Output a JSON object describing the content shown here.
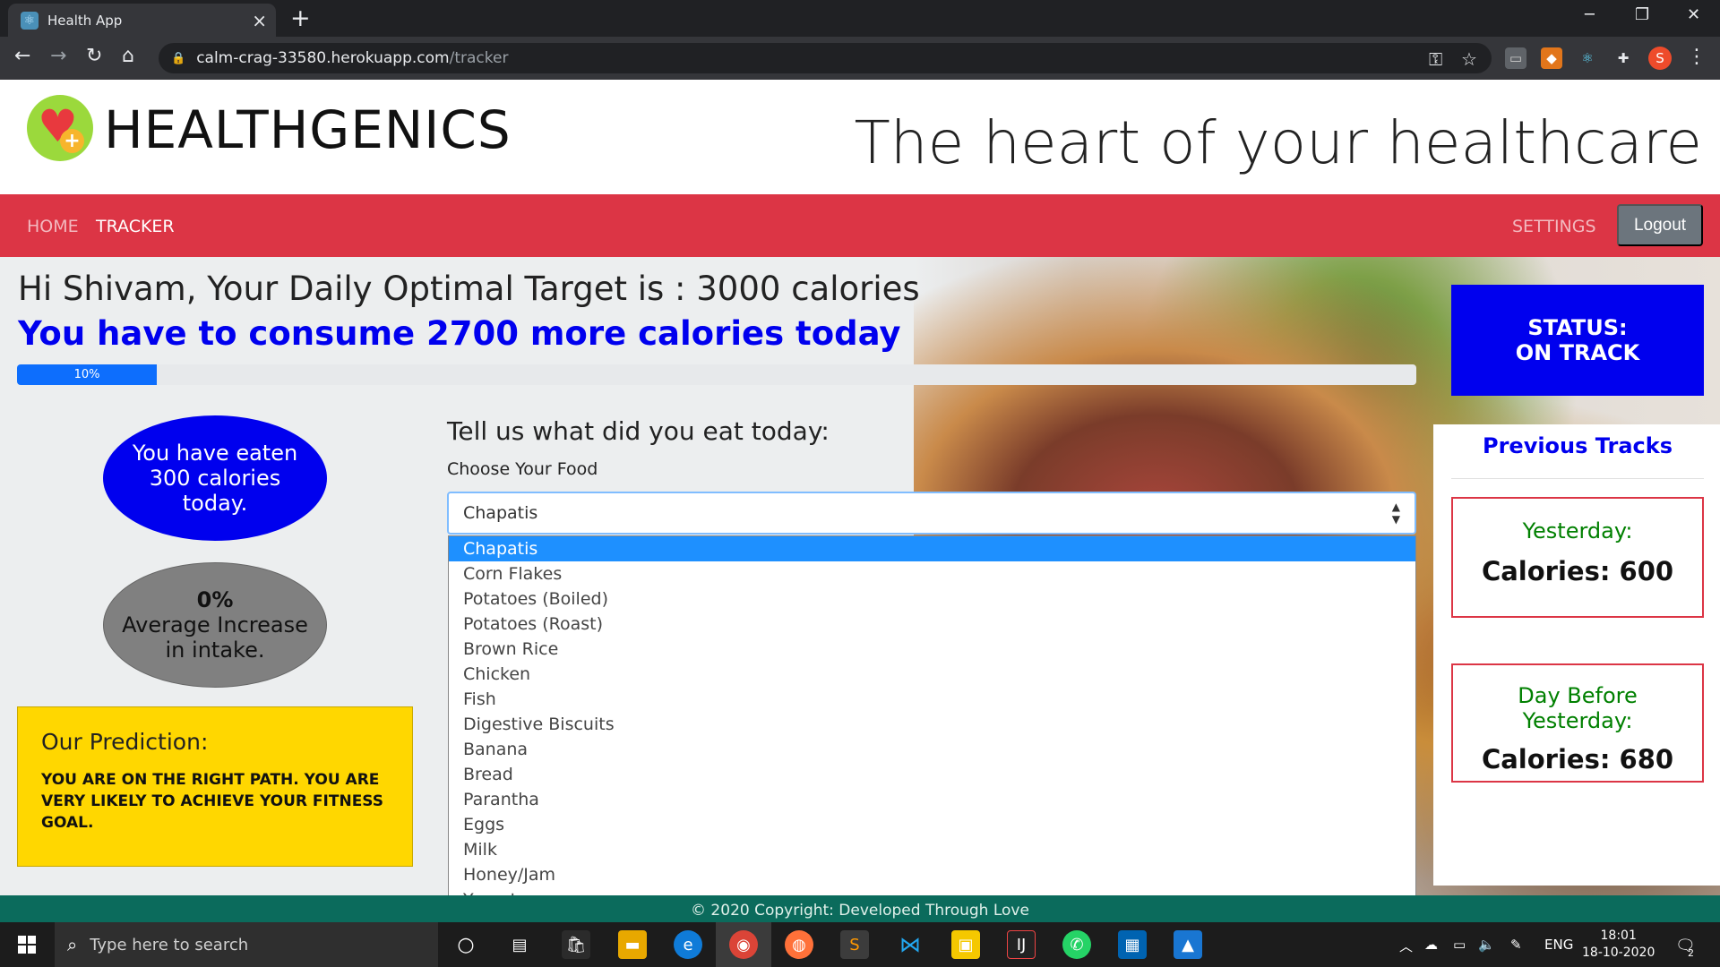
{
  "browser": {
    "tab_title": "Health App",
    "url_host": "calm-crag-33580.herokuapp.com",
    "url_path": "/tracker",
    "profile_initial": "S"
  },
  "header": {
    "brand": "HEALTHGENICS",
    "tagline": "The heart of your healthcare"
  },
  "nav": {
    "home": "HOME",
    "tracker": "TRACKER",
    "settings": "SETTINGS",
    "logout": "Logout"
  },
  "summary": {
    "greeting": "Hi Shivam, Your Daily Optimal Target is : 3000 calories",
    "remaining": "You have to consume 2700 more calories today",
    "progress_label": "10%",
    "progress_value": 0.1
  },
  "status": {
    "line1": "STATUS:",
    "line2": "ON TRACK"
  },
  "eaten": {
    "line1": "You have eaten",
    "line2": "300 calories",
    "line3": "today."
  },
  "average": {
    "percent": "0%",
    "line2": "Average Increase",
    "line3": "in intake."
  },
  "prediction": {
    "title": "Our Prediction:",
    "text": "YOU ARE ON THE RIGHT PATH. YOU ARE VERY LIKELY TO ACHIEVE YOUR FITNESS GOAL."
  },
  "form": {
    "question": "Tell us what did you eat today:",
    "label": "Choose Your Food",
    "selected": "Chapatis",
    "options": [
      "Chapatis",
      "Corn Flakes",
      "Potatoes (Boiled)",
      "Potatoes (Roast)",
      "Brown Rice",
      "Chicken",
      "Fish",
      "Digestive Biscuits",
      "Banana",
      "Bread",
      "Parantha",
      "Eggs",
      "Milk",
      "Honey/Jam",
      "Yogurt"
    ]
  },
  "tracks": {
    "title": "Previous Tracks",
    "yesterday_label": "Yesterday:",
    "yesterday_cal": "Calories: 600",
    "daybefore_label1": "Day Before",
    "daybefore_label2": "Yesterday:",
    "daybefore_cal": "Calories: 680"
  },
  "footer": {
    "text": "© 2020 Copyright: Developed Through Love"
  },
  "taskbar": {
    "search_placeholder": "Type here to search",
    "lang": "ENG",
    "time": "18:01",
    "date": "18-10-2020",
    "notifications": "2"
  },
  "colors": {
    "navbar": "#dc3545",
    "accent_blue": "#0000ee",
    "prediction": "#ffd700",
    "footer": "#0b6b5c"
  }
}
